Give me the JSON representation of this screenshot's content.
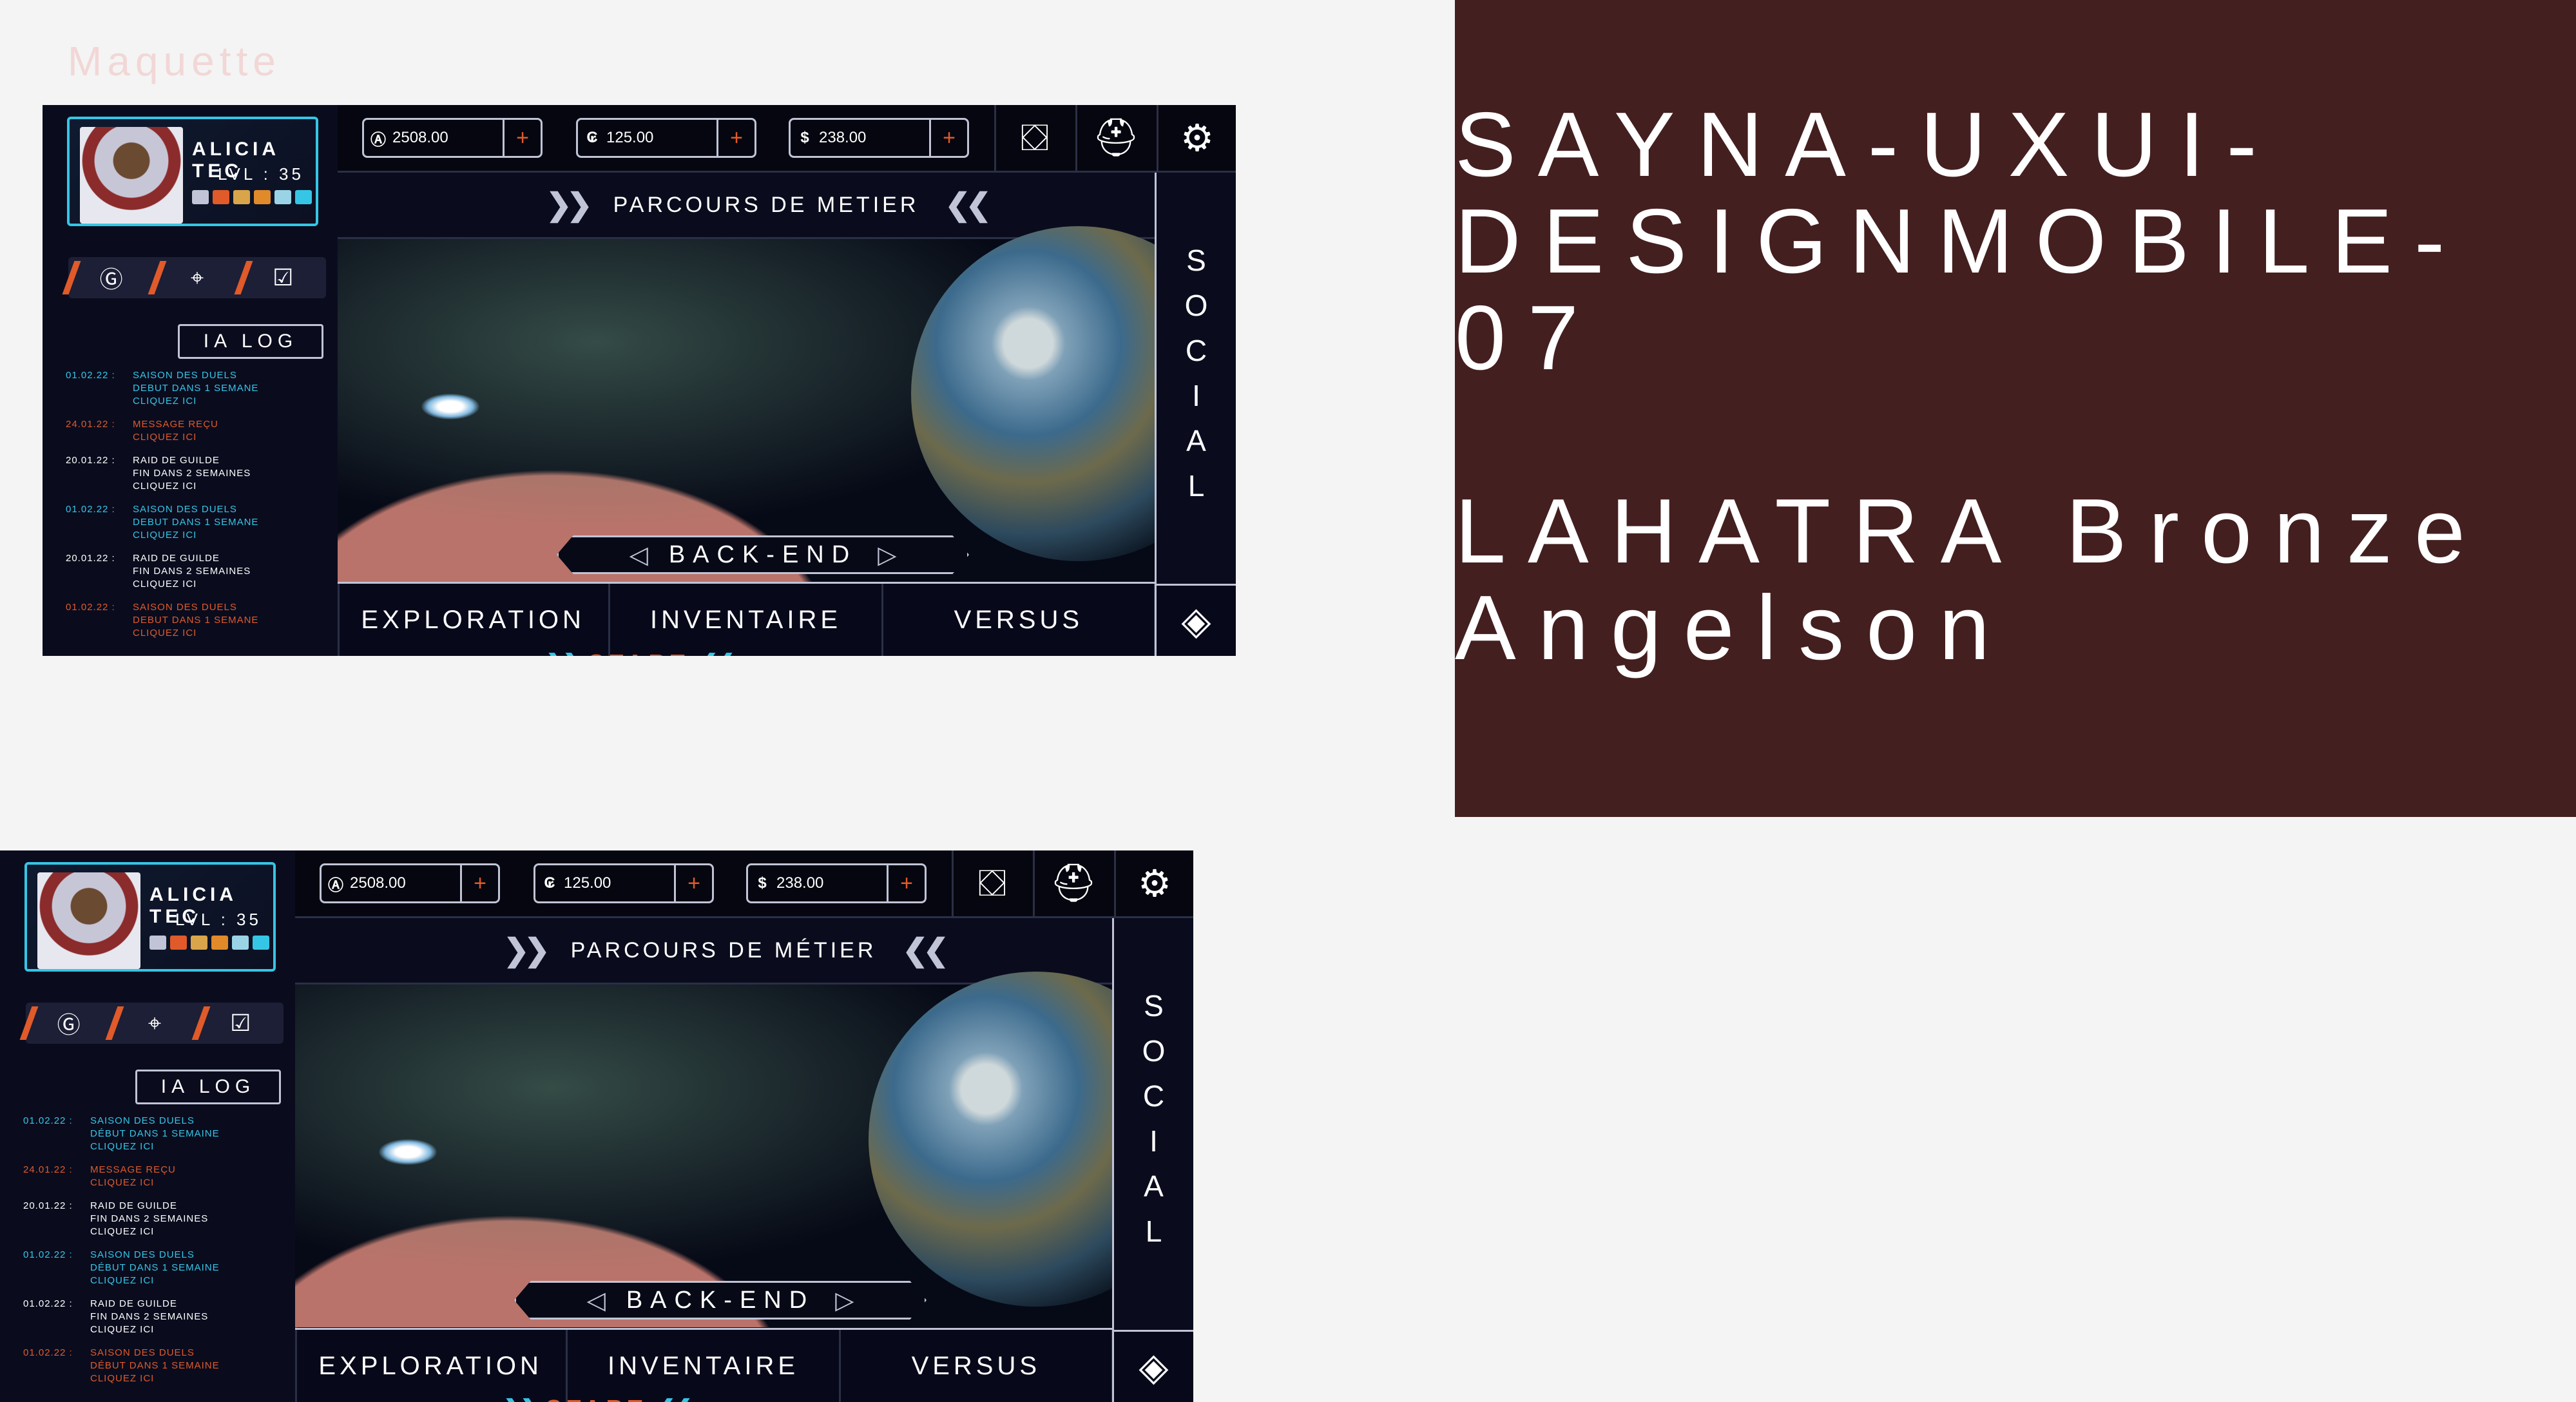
{
  "labels": {
    "maquette": "Maquette"
  },
  "title": "SAYNA-UXUI-\nDESIGNMOBILE-07\n\nLAHATRA Bronze\nAngelson",
  "colors": {
    "accent": "#e05a2a",
    "cyan": "#35c6e6",
    "panel": "#441f1f",
    "screen_bg": "#07091a"
  },
  "screens": [
    {
      "profile": {
        "name": "ALICIA TEC",
        "level": "LVL : 35"
      },
      "resources": [
        {
          "icon": "credit-icon",
          "value": "2508.00"
        },
        {
          "icon": "coin-c-icon",
          "value": "125.00"
        },
        {
          "icon": "dollar-icon",
          "value": "238.00"
        }
      ],
      "parcours": "PARCOURS DE METIER",
      "ialog_title": "IA LOG",
      "logs": [
        {
          "date": "01.02.22 :",
          "text": "SAISON DES DUELS\nDEBUT DANS 1 SEMANE\nCLIQUEZ ICI",
          "color": "#35c6e6"
        },
        {
          "date": "24.01.22 :",
          "text": "MESSAGE REÇU\nCLIQUEZ ICI",
          "color": "#e05a2a"
        },
        {
          "date": "20.01.22 :",
          "text": "RAID DE GUILDE\nFIN DANS 2 SEMAINES\nCLIQUEZ ICI",
          "color": "#ffffff"
        },
        {
          "date": "01.02.22 :",
          "text": "SAISON DES DUELS\nDEBUT DANS 1 SEMANE\nCLIQUEZ ICI",
          "color": "#35c6e6"
        },
        {
          "date": "20.01.22 :",
          "text": "RAID DE GUILDE\nFIN DANS 2 SEMAINES\nCLIQUEZ ICI",
          "color": "#ffffff"
        },
        {
          "date": "01.02.22 :",
          "text": "SAISON DES DUELS\nDEBUT DANS 1 SEMANE\nCLIQUEZ ICI",
          "color": "#e05a2a"
        }
      ],
      "mission": "BACK-END",
      "start": "START",
      "social": "SOCIAL",
      "nav": [
        "EXPLORATION",
        "INVENTAIRE",
        "VERSUS"
      ]
    },
    {
      "profile": {
        "name": "ALICIA TEC",
        "level": "LVL : 35"
      },
      "resources": [
        {
          "icon": "credit-icon",
          "value": "2508.00"
        },
        {
          "icon": "coin-c-icon",
          "value": "125.00"
        },
        {
          "icon": "dollar-icon",
          "value": "238.00"
        }
      ],
      "parcours": "PARCOURS DE MÉTIER",
      "ialog_title": "IA LOG",
      "logs": [
        {
          "date": "01.02.22 :",
          "text": "SAISON DES DUELS\nDÉBUT DANS 1 SEMAINE\nCLIQUEZ ICI",
          "color": "#35c6e6"
        },
        {
          "date": "24.01.22 :",
          "text": "MESSAGE REÇU\nCLIQUEZ ICI",
          "color": "#e05a2a"
        },
        {
          "date": "20.01.22 :",
          "text": "RAID DE GUILDE\nFIN DANS 2 SEMAINES\nCLIQUEZ ICI",
          "color": "#ffffff"
        },
        {
          "date": "01.02.22 :",
          "text": "SAISON DES DUELS\nDÉBUT DANS 1 SEMAINE\nCLIQUEZ ICI",
          "color": "#35c6e6"
        },
        {
          "date": "01.02.22 :",
          "text": "RAID DE GUILDE\nFIN DANS 2 SEMAINES\nCLIQUEZ ICI",
          "color": "#ffffff"
        },
        {
          "date": "01.02.22 :",
          "text": "SAISON DES DUELS\nDÉBUT DANS 1 SEMAINE\nCLIQUEZ ICI",
          "color": "#e05a2a"
        }
      ],
      "mission": "BACK-END",
      "start": "START",
      "social": "SOCIAL",
      "nav": [
        "EXPLORATION",
        "INVENTAIRE",
        "VERSUS"
      ]
    }
  ]
}
